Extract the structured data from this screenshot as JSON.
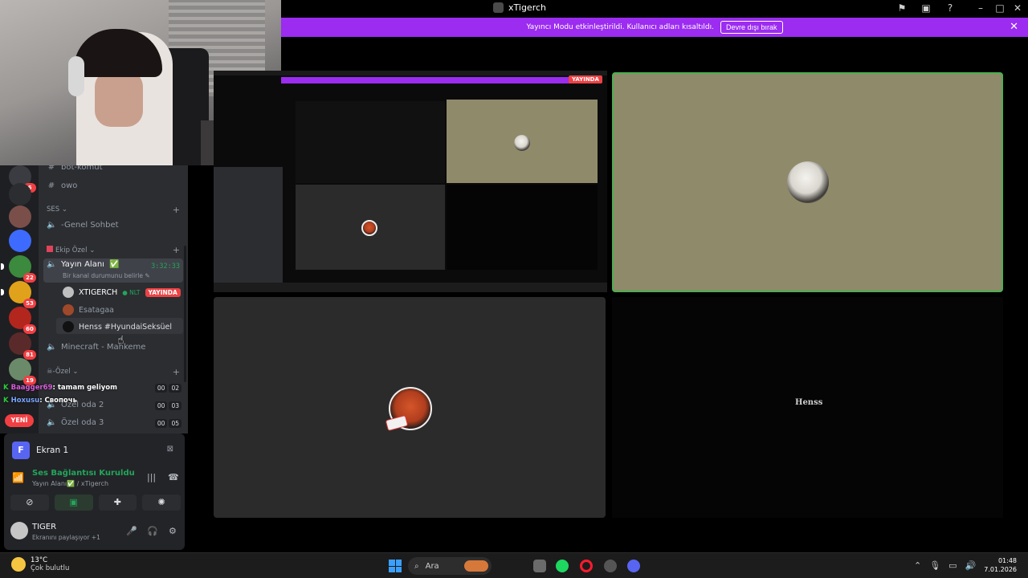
{
  "window": {
    "title": "xTigerch"
  },
  "banner": {
    "message": "Yayıncı Modu etkinleştirildi. Kullanıcı adları kısaltıldı.",
    "button": "Devre dışı bırak"
  },
  "servers": {
    "badges": [
      "6",
      "22",
      "53",
      "60",
      "81",
      "19"
    ],
    "new_label": "YENİ"
  },
  "channels": {
    "text": [
      {
        "name": "bot-komut"
      },
      {
        "name": "owo"
      }
    ],
    "voice_category": "SES",
    "genel": "-Genel Sohbet",
    "ekip_category": "Ekip Özel",
    "active_voice": {
      "name": "Yayın Alanı",
      "status_hint": "Bir kanal durumunu belirle",
      "timer": "3:32:33"
    },
    "users": [
      {
        "name": "XTIGERCH",
        "tag": "NLT",
        "badge": "YAYINDA"
      },
      {
        "name": "Esatagaa"
      },
      {
        "name": "Henss #HyundaiSeksüel"
      }
    ],
    "minecraft": "Minecraft - Mahkeme",
    "ozel_category": "-Özel",
    "ozel_rooms": [
      {
        "name": "Özel oda 2",
        "a": "00",
        "b": "03"
      },
      {
        "name": "Özel oda 3",
        "a": "00",
        "b": "05"
      }
    ],
    "first_counts": {
      "a": "00",
      "b": "02"
    }
  },
  "chat_overlay": [
    {
      "user": "Baagger69",
      "text": ": tamam geliyom"
    },
    {
      "user": "Hoxusu",
      "text": ": Свопочь"
    }
  ],
  "panel": {
    "screen": {
      "initial": "F",
      "label": "Ekran 1"
    },
    "connection": {
      "title": "Ses Bağlantısı Kuruldu",
      "sub": "Yayın Alanı✅ / xTigerch"
    },
    "user": {
      "name": "TIGER",
      "status": "Ekranını paylaşıyor +1"
    }
  },
  "stage": {
    "nested_live": "YAYINDA",
    "henss_logo": "Henss"
  },
  "taskbar": {
    "weather_temp": "13°C",
    "weather_desc": "Çok bulutlu",
    "search_placeholder": "Ara",
    "time": "01:48",
    "date": "7.01.2026"
  }
}
